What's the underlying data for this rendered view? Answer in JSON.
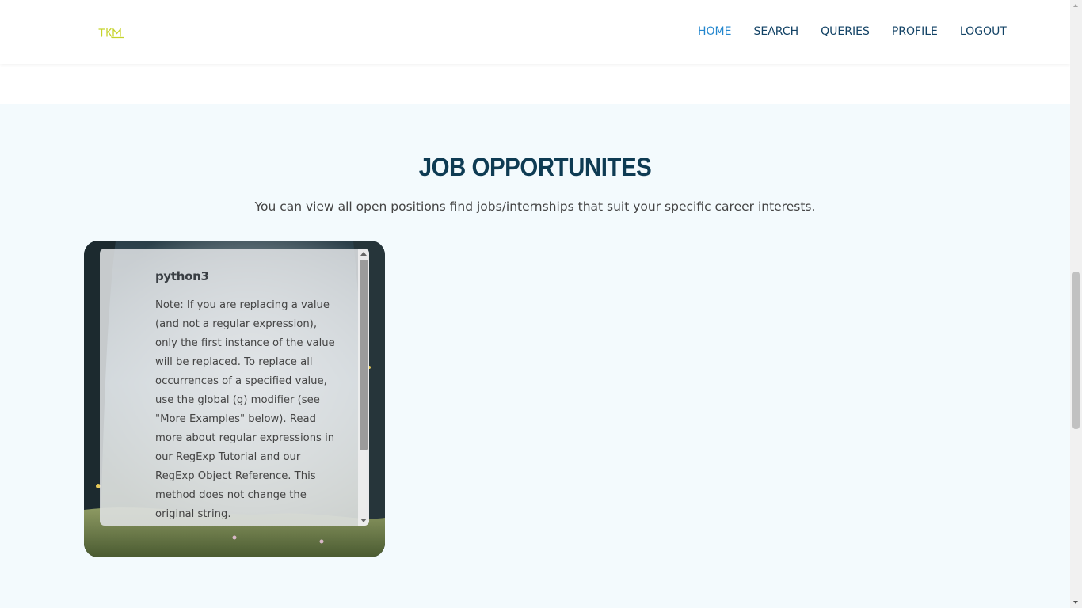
{
  "header": {
    "logo_text": "TKM",
    "nav": [
      {
        "label": "HOME",
        "active": true
      },
      {
        "label": "SEARCH",
        "active": false
      },
      {
        "label": "QUERIES",
        "active": false
      },
      {
        "label": "PROFILE",
        "active": false
      },
      {
        "label": "LOGOUT",
        "active": false
      }
    ]
  },
  "section": {
    "title": "JOB OPPORTUNITES",
    "subtitle": "You can view all open positions find jobs/internships that suit your specific career interests."
  },
  "job_card": {
    "title": "python3",
    "description": "Note: If you are replacing a value (and not a regular expression), only the first instance of the value will be replaced. To replace all occurrences of a specified value, use the global (g) modifier (see \"More Examples\" below). Read more about regular expressions in our RegExp Tutorial and our RegExp Object Reference. This method does not change the original string."
  },
  "colors": {
    "nav_text": "#124265",
    "nav_active": "#2487ce",
    "title": "#0e3b53",
    "section_bg": "#f3fafd",
    "logo": "#c5d32b"
  },
  "icons": {
    "logo": "tkm-logo-icon",
    "scroll_up": "chevron-up-icon",
    "scroll_down": "chevron-down-icon"
  }
}
